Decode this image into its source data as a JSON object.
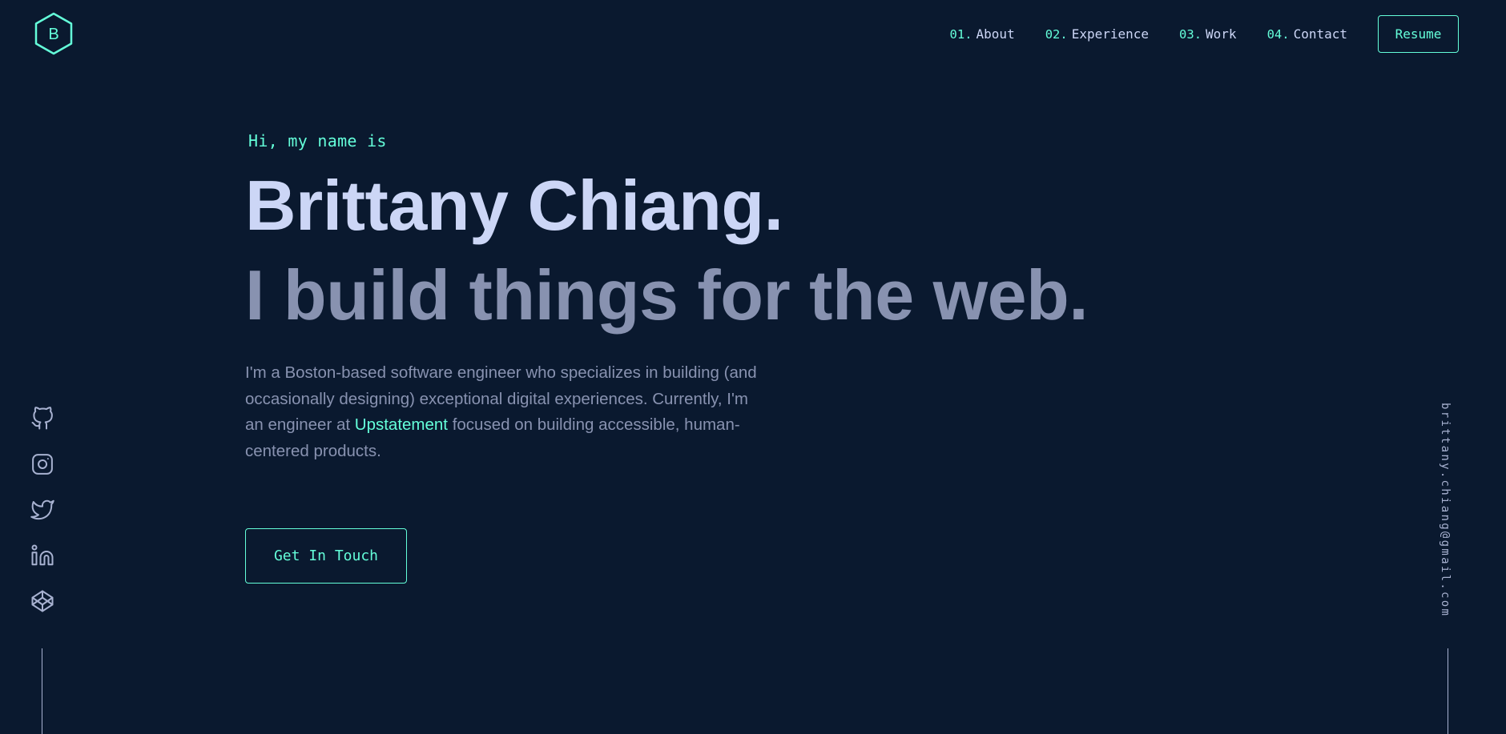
{
  "colors": {
    "background": "#0a192f",
    "accent": "#64ffda",
    "heading": "#ccd6f6",
    "text": "#8892b0"
  },
  "logo": {
    "letter": "B",
    "icon": "hexagon-logo-icon"
  },
  "nav": {
    "items": [
      {
        "num": "01.",
        "label": "About"
      },
      {
        "num": "02.",
        "label": "Experience"
      },
      {
        "num": "03.",
        "label": "Work"
      },
      {
        "num": "04.",
        "label": "Contact"
      }
    ],
    "resume_label": "Resume"
  },
  "hero": {
    "intro": "Hi, my name is",
    "name": "Brittany Chiang.",
    "tagline": "I build things for the web.",
    "description_start": "I'm a Boston-based software engineer who specializes in building (and occasionally designing) exceptional digital experiences. Currently, I'm an engineer at ",
    "company": "Upstatement",
    "description_end": " focused on building accessible, human-centered products.",
    "cta_label": "Get In Touch"
  },
  "social": {
    "icons": [
      "github-icon",
      "instagram-icon",
      "twitter-icon",
      "linkedin-icon",
      "codepen-icon"
    ]
  },
  "email": "brittany.chiang@gmail.com"
}
